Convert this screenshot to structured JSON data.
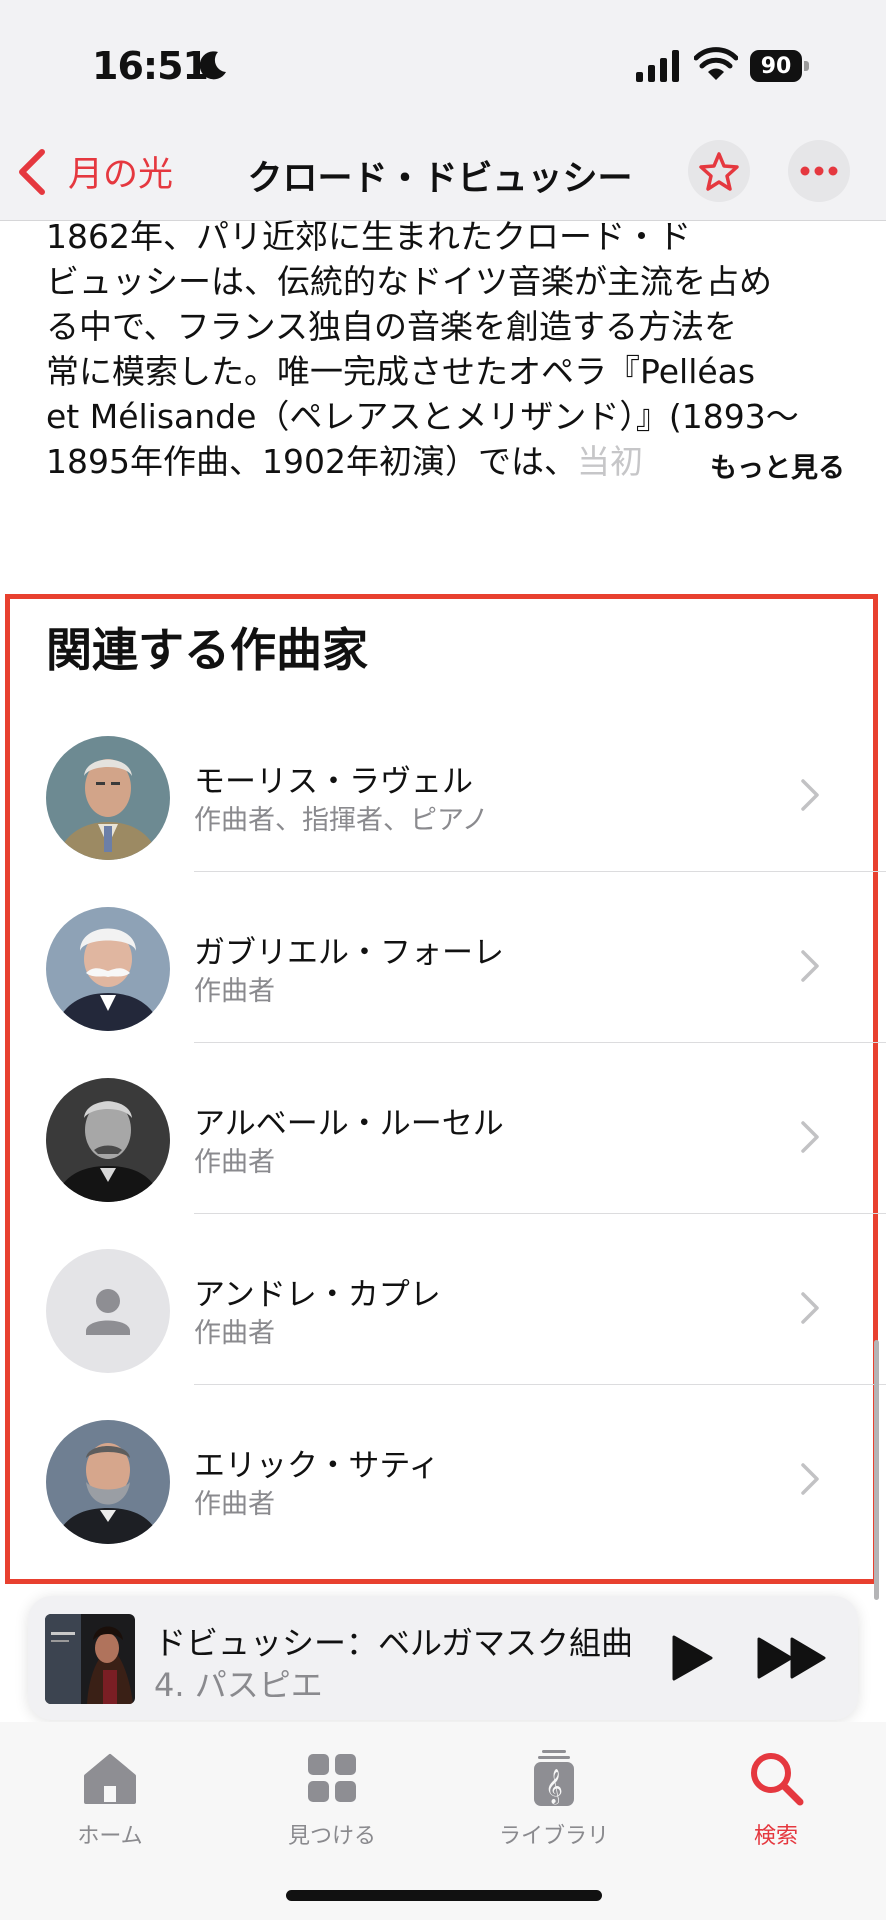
{
  "status": {
    "time": "16:51",
    "battery": "90"
  },
  "nav": {
    "back_label": "月の光",
    "title": "クロード・ドビュッシー"
  },
  "bio": {
    "lines": [
      "1862年、パリ近郊に生まれたクロード・ド",
      "ビュッシーは、伝統的なドイツ音楽が主流を占め",
      "る中で、フランス独自の音楽を創造する方法を",
      "常に模索した。唯一完成させたオペラ『Pelléas",
      "et Mélisande（ペレアスとメリザンド）』(1893～",
      "1895年作曲、1902年初演）では、"
    ],
    "fade_text": "当初",
    "more_label": "もっと見る"
  },
  "related": {
    "title": "関連する作曲家",
    "items": [
      {
        "name": "モーリス・ラヴェル",
        "role": "作曲者、指揮者、ピアノ"
      },
      {
        "name": "ガブリエル・フォーレ",
        "role": "作曲者"
      },
      {
        "name": "アルベール・ルーセル",
        "role": "作曲者"
      },
      {
        "name": "アンドレ・カプレ",
        "role": "作曲者"
      },
      {
        "name": "エリック・サティ",
        "role": "作曲者"
      }
    ]
  },
  "player": {
    "title": "ドビュッシー：ベルガマスク組曲",
    "subtitle": "4. パスピエ"
  },
  "tabs": [
    {
      "label": "ホーム",
      "icon": "house-icon"
    },
    {
      "label": "見つける",
      "icon": "grid-icon"
    },
    {
      "label": "ライブラリ",
      "icon": "library-icon"
    },
    {
      "label": "検索",
      "icon": "search-icon"
    }
  ],
  "colors": {
    "accent": "#e5383f",
    "highlight_frame": "#e8402f",
    "secondary_text": "#8a8a8e"
  }
}
